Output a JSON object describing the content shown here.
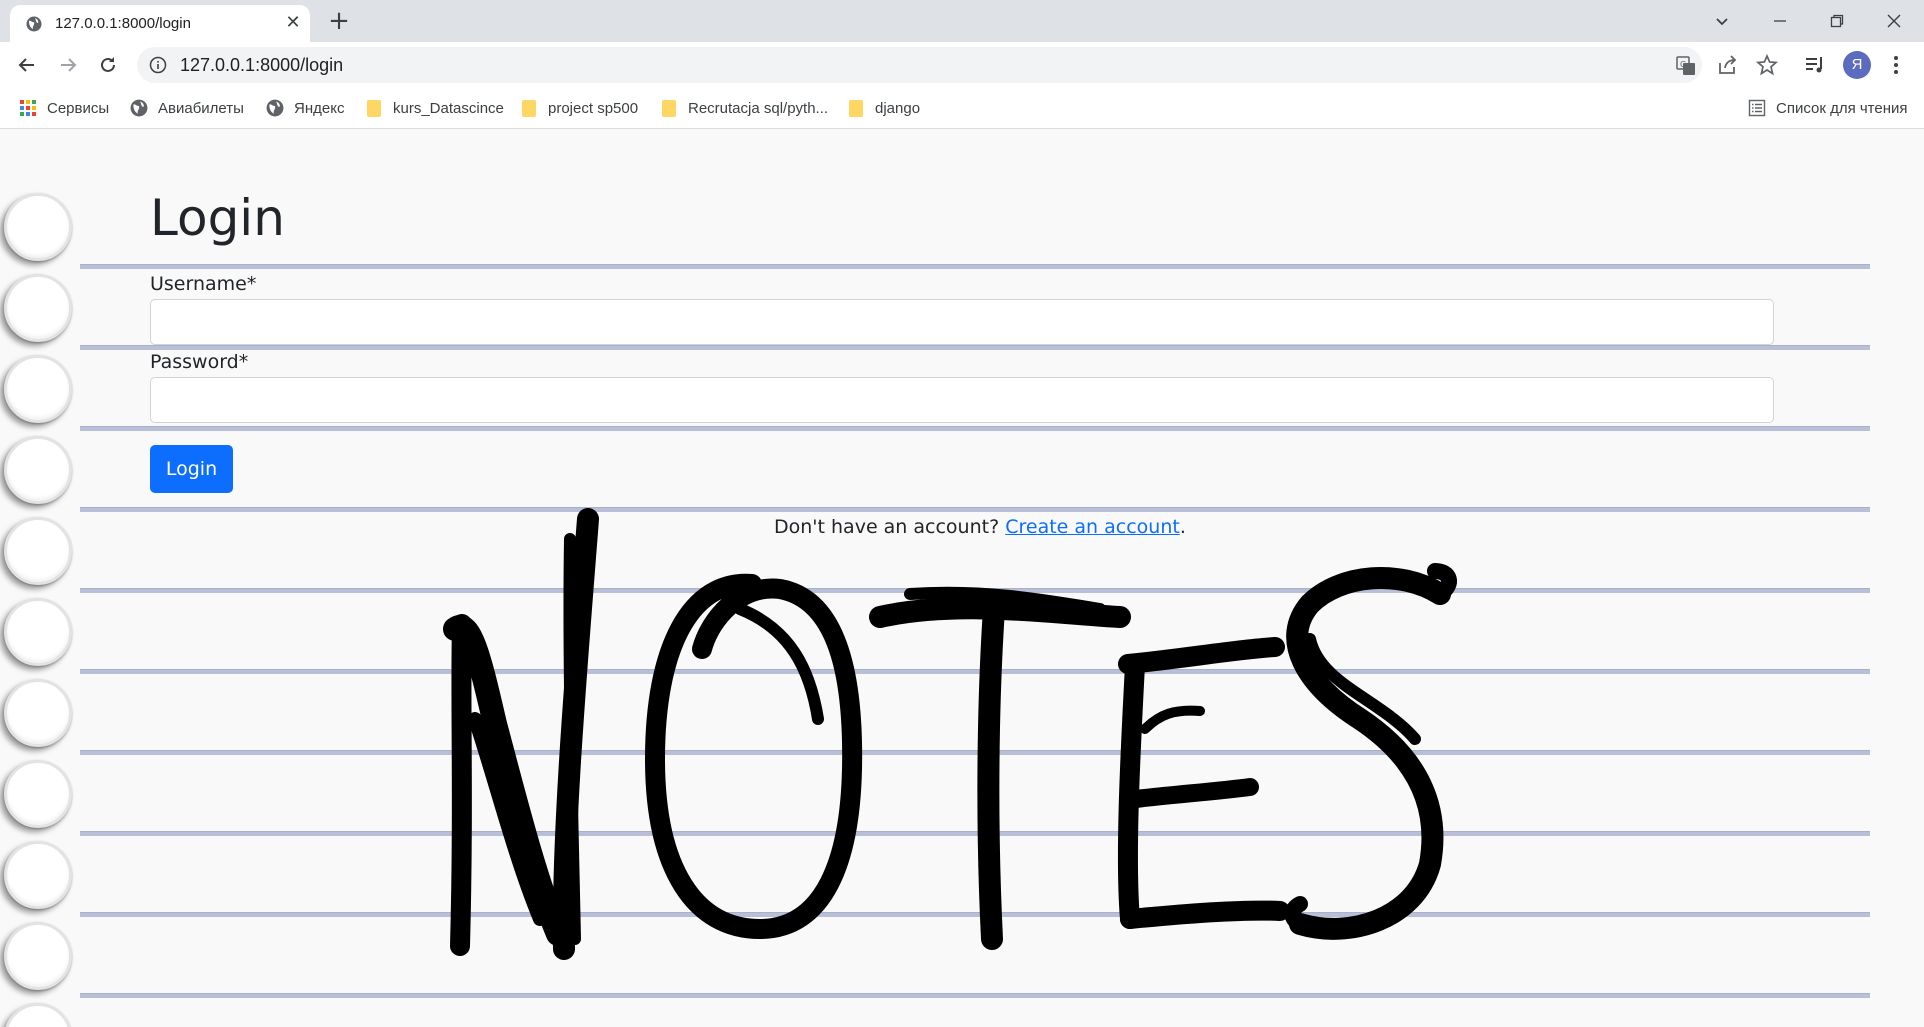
{
  "browser": {
    "tab_title": "127.0.0.1:8000/login",
    "url": "127.0.0.1:8000/login",
    "avatar_letter": "Я",
    "bookmarks": [
      {
        "label": "Сервисы",
        "icon": "apps-grid-icon"
      },
      {
        "label": "Авиабилеты",
        "icon": "globe-icon"
      },
      {
        "label": "Яндекс",
        "icon": "globe-icon"
      },
      {
        "label": "kurs_Datascince",
        "icon": "folder-icon"
      },
      {
        "label": "project sp500",
        "icon": "folder-icon"
      },
      {
        "label": "Recrutacja sql/pyth...",
        "icon": "folder-icon"
      },
      {
        "label": "django",
        "icon": "folder-icon"
      }
    ],
    "reading_list_label": "Список для чтения"
  },
  "page": {
    "title": "Login",
    "username_label": "Username*",
    "username_value": "",
    "password_label": "Password*",
    "password_value": "",
    "login_button": "Login",
    "signup_prefix": "Don't have an account? ",
    "signup_link": "Create an account",
    "signup_suffix": ".",
    "background_art": "NOTES"
  },
  "colors": {
    "primary": "#0d6efd",
    "rule_line": "#b9bfd6",
    "page_bg": "#f9f9f9"
  }
}
